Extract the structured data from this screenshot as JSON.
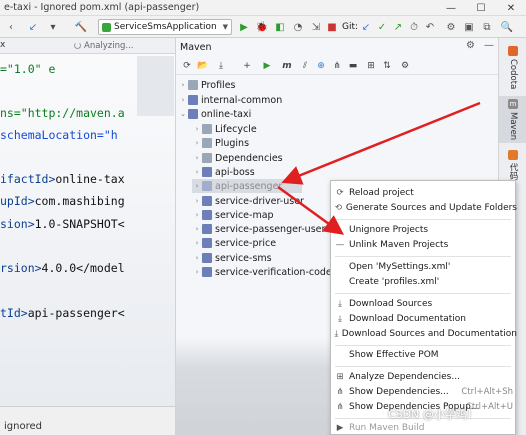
{
  "window": {
    "title": "e-taxi - Ignored pom.xml (api-passenger)",
    "controls": [
      "—",
      "☐",
      "✕"
    ]
  },
  "toolbar": {
    "run_config": "ServiceSmsApplication",
    "git_label": "Git:"
  },
  "editor": {
    "tab_close": "x",
    "analyzing": "Analyzing...",
    "lines": [
      {
        "t": "str",
        "v": "=\"1.0\" e"
      },
      {
        "t": "str",
        "v": "ns=\"http://maven.a"
      },
      {
        "t": "attr",
        "v": " schemaLocation=\"h"
      },
      {
        "t": "tag",
        "v": "ifactId>",
        "rest": "online-tax"
      },
      {
        "t": "tag",
        "v": "upId>",
        "rest": "com.mashibing"
      },
      {
        "t": "tag",
        "v": "sion>",
        "rest": "1.0-SNAPSHOT<"
      },
      {
        "t": "tag",
        "v": "rsion>",
        "rest": "4.0.0</model"
      },
      {
        "t": "tag",
        "v": "tId>",
        "rest": "api-passenger<"
      }
    ],
    "bottom_text": "ignored"
  },
  "maven": {
    "title": "Maven",
    "tree": [
      {
        "label": "Profiles",
        "level": 0,
        "arrow": "›",
        "icon": "folder"
      },
      {
        "label": "internal-common",
        "level": 0,
        "arrow": "›",
        "icon": "maven"
      },
      {
        "label": "online-taxi",
        "level": 0,
        "arrow": "⌄",
        "icon": "maven"
      },
      {
        "label": "Lifecycle",
        "level": 1,
        "arrow": "›",
        "icon": "folder"
      },
      {
        "label": "Plugins",
        "level": 1,
        "arrow": "›",
        "icon": "folder"
      },
      {
        "label": "Dependencies",
        "level": 1,
        "arrow": "›",
        "icon": "folder"
      },
      {
        "label": "api-boss",
        "level": 1,
        "arrow": "›",
        "icon": "maven"
      },
      {
        "label": "api-passenger",
        "level": 1,
        "arrow": "›",
        "icon": "maven",
        "selected": true
      },
      {
        "label": "service-driver-user",
        "level": 1,
        "arrow": "›",
        "icon": "maven"
      },
      {
        "label": "service-map",
        "level": 1,
        "arrow": "›",
        "icon": "maven"
      },
      {
        "label": "service-passenger-user",
        "level": 1,
        "arrow": "›",
        "icon": "maven"
      },
      {
        "label": "service-price",
        "level": 1,
        "arrow": "›",
        "icon": "maven"
      },
      {
        "label": "service-sms",
        "level": 1,
        "arrow": "›",
        "icon": "maven"
      },
      {
        "label": "service-verification-code",
        "level": 1,
        "arrow": "›",
        "icon": "maven"
      }
    ]
  },
  "side_tabs": [
    {
      "label": "Codota",
      "color": "#e0662d"
    },
    {
      "label": "Maven",
      "color": "#8a8a8a"
    },
    {
      "label": "代码",
      "color": "#e07a2d"
    }
  ],
  "context_menu": {
    "groups": [
      [
        {
          "label": "Reload project",
          "icon": "reload-icon"
        },
        {
          "label": "Generate Sources and Update Folders",
          "icon": "generate-icon"
        }
      ],
      [
        {
          "label": "Unignore Projects",
          "icon": ""
        },
        {
          "label": "Unlink Maven Projects",
          "icon": "minus-icon"
        }
      ],
      [
        {
          "label": "Open 'MySettings.xml'",
          "icon": ""
        },
        {
          "label": "Create 'profiles.xml'",
          "icon": ""
        }
      ],
      [
        {
          "label": "Download Sources",
          "icon": "download-icon"
        },
        {
          "label": "Download Documentation",
          "icon": "download-icon"
        },
        {
          "label": "Download Sources and Documentation",
          "icon": "download-icon"
        }
      ],
      [
        {
          "label": "Show Effective POM",
          "icon": ""
        }
      ],
      [
        {
          "label": "Analyze Dependencies...",
          "icon": "analyze-icon"
        },
        {
          "label": "Show Dependencies...",
          "icon": "diagram-icon",
          "shortcut": "Ctrl+Alt+Sh"
        },
        {
          "label": "Show Dependencies Popup...",
          "icon": "diagram-icon",
          "shortcut": "Ctrl+Alt+U"
        }
      ],
      [
        {
          "label": "Run Maven Build",
          "icon": "run-icon",
          "disabled": true
        }
      ]
    ]
  },
  "watermark": "CSDN @小学鸡！",
  "colors": {
    "annotation_arrow": "#e02020",
    "selected_row": "#d7dbe2",
    "editor_string": "#0a7d1f",
    "editor_tag": "#0b3f91"
  }
}
